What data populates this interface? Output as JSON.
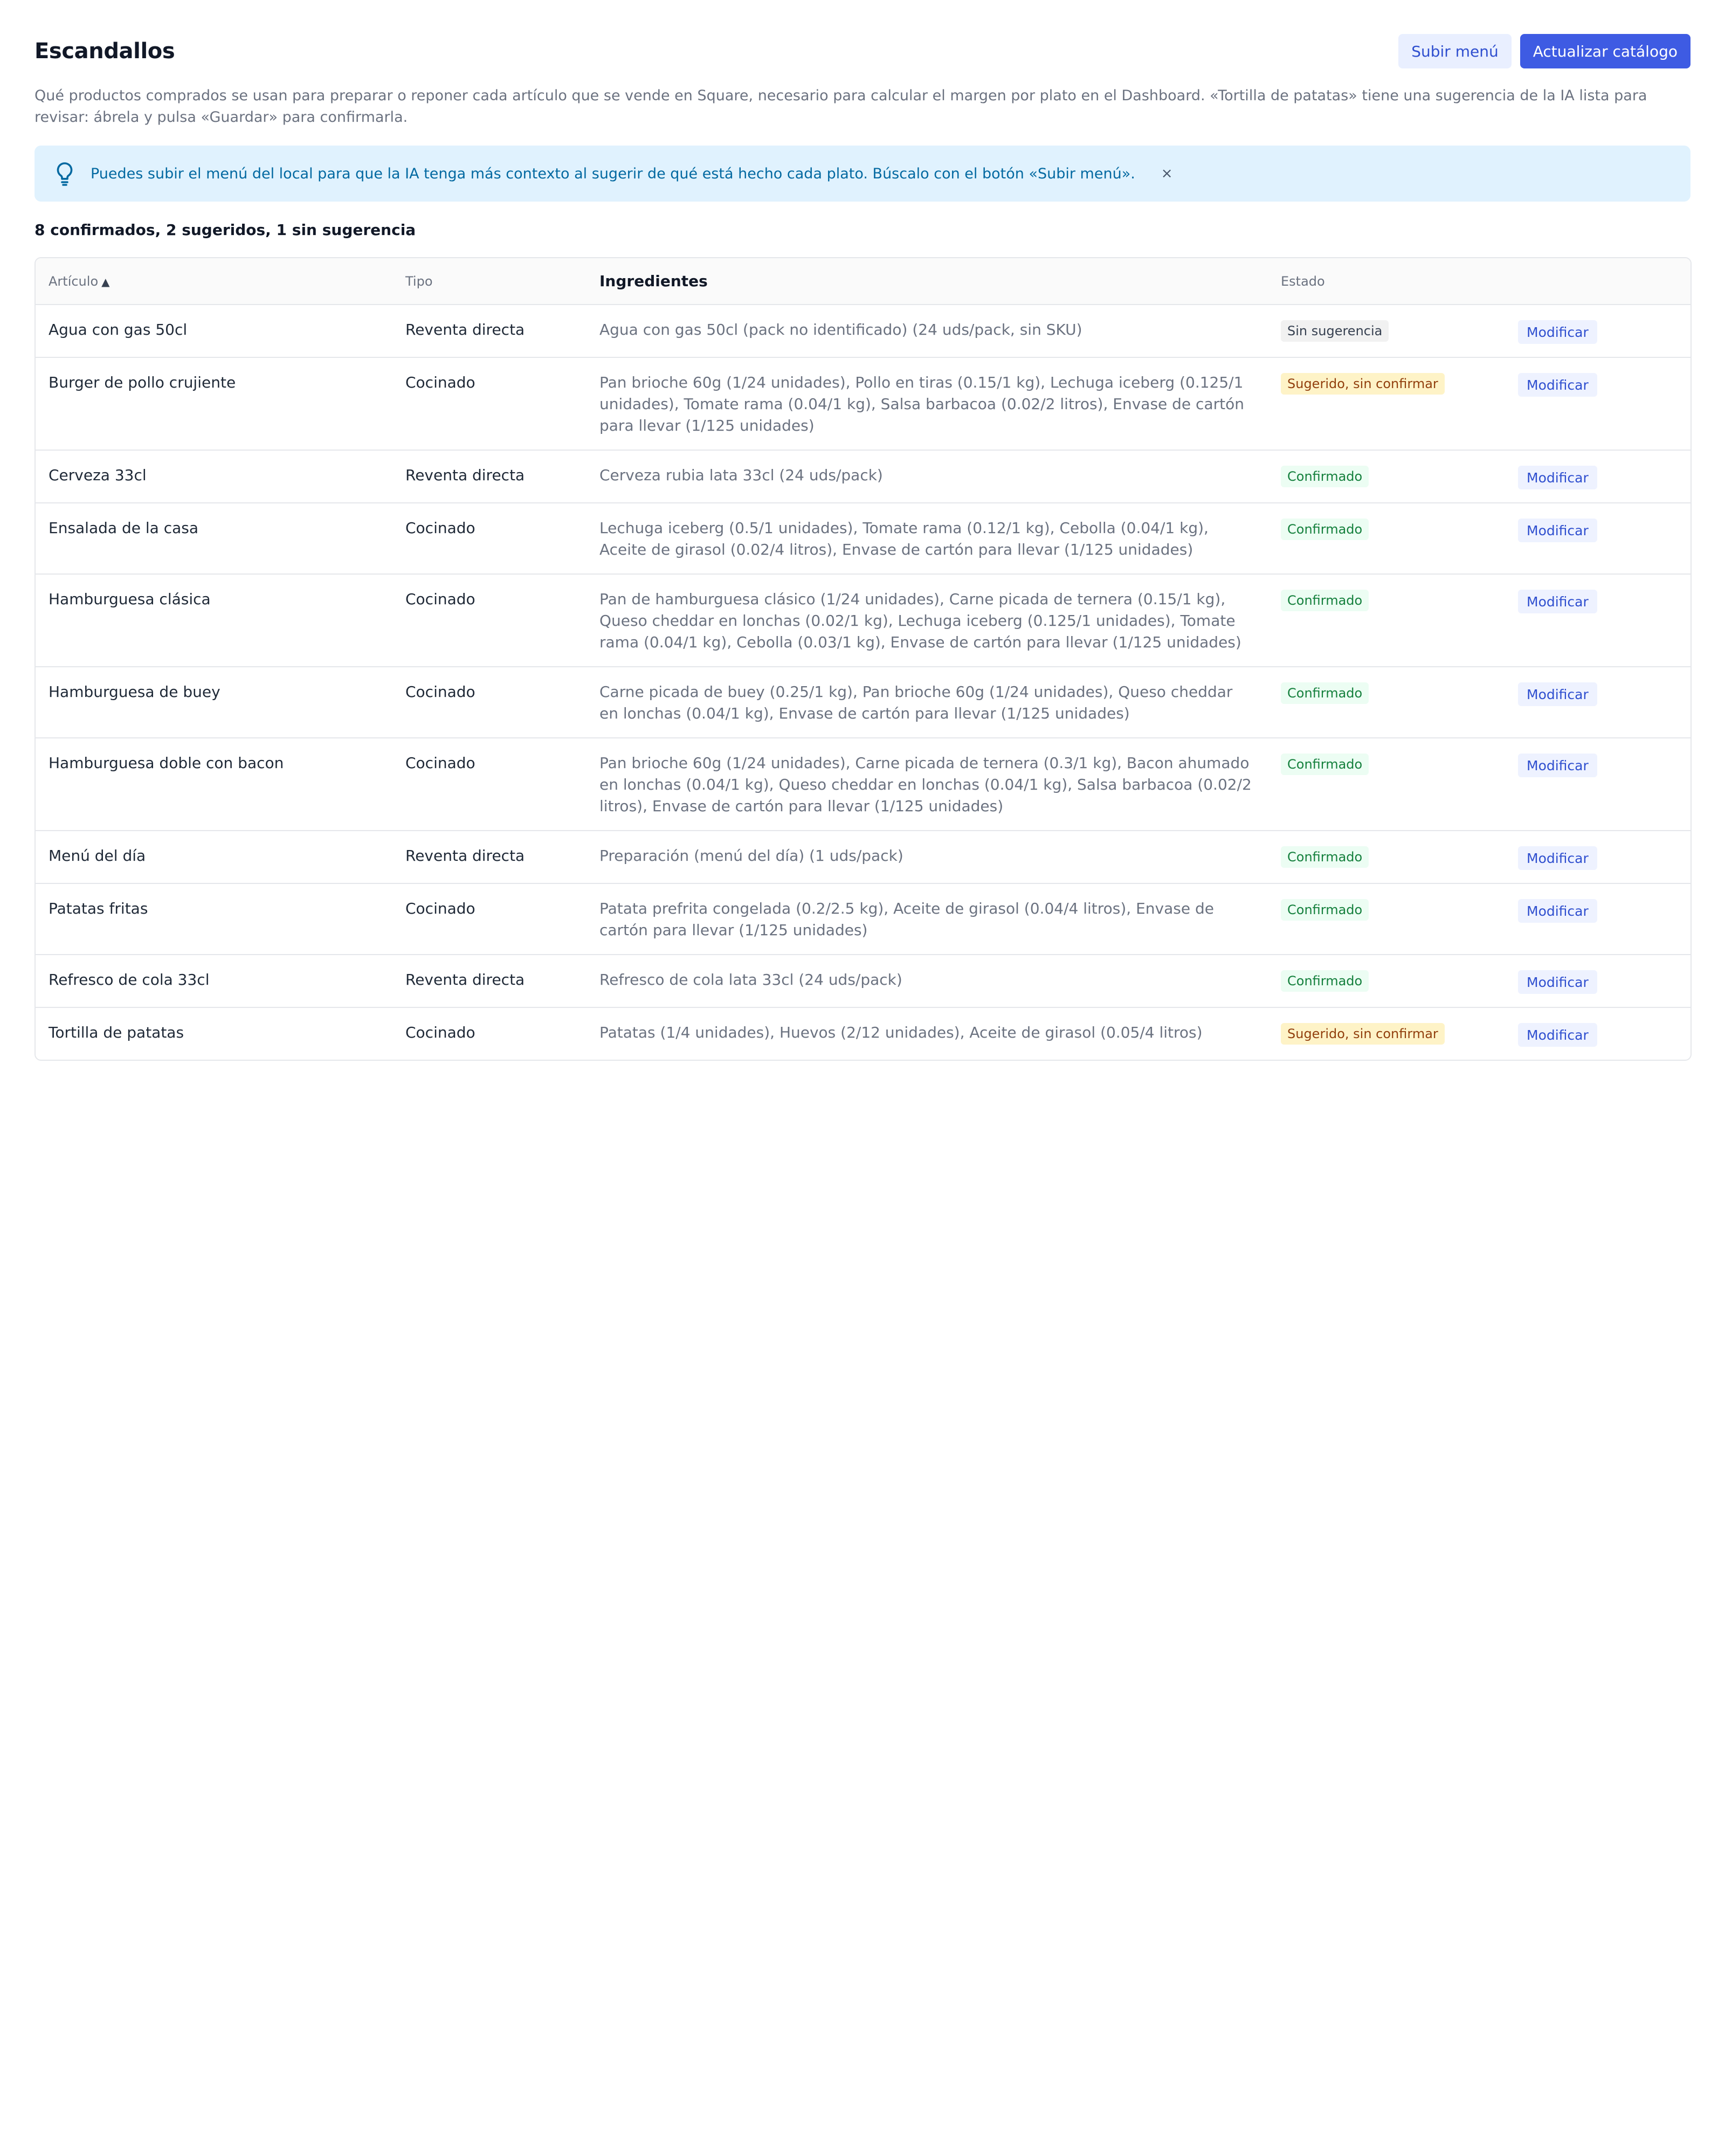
{
  "header": {
    "title": "Escandallos",
    "upload_menu_label": "Subir menú",
    "update_catalog_label": "Actualizar catálogo"
  },
  "description": "Qué productos comprados se usan para preparar o reponer cada artículo que se vende en Square, necesario para calcular el margen por plato en el Dashboard. «Tortilla de patatas» tiene una sugerencia de la IA lista para revisar: ábrela y pulsa «Guardar» para confirmarla.",
  "banner": {
    "icon": "lightbulb-icon",
    "text": "Puedes subir el menú del local para que la IA tenga más contexto al sugerir de qué está hecho cada plato. Búscalo con el botón «Subir menú».",
    "close": "×"
  },
  "summary": "8 confirmados, 2 sugeridos, 1 sin sugerencia",
  "table": {
    "columns": {
      "article": "Artículo",
      "sort_indicator": "▲",
      "type": "Tipo",
      "ingredients": "Ingredientes",
      "status": "Estado"
    },
    "action_label": "Modificar",
    "rows": [
      {
        "article": "Agua con gas 50cl",
        "type": "Reventa directa",
        "ingredients": "Agua con gas 50cl (pack no identificado) (24 uds/pack, sin SKU)",
        "status": "Sin sugerencia",
        "status_kind": "gray"
      },
      {
        "article": "Burger de pollo crujiente",
        "type": "Cocinado",
        "ingredients": "Pan brioche 60g (1/24 unidades), Pollo en tiras (0.15/1 kg), Lechuga iceberg (0.125/1 unidades), Tomate rama (0.04/1 kg), Salsa barbacoa (0.02/2 litros), Envase de cartón para llevar (1/125 unidades)",
        "status": "Sugerido, sin confirmar",
        "status_kind": "yellow"
      },
      {
        "article": "Cerveza 33cl",
        "type": "Reventa directa",
        "ingredients": "Cerveza rubia lata 33cl (24 uds/pack)",
        "status": "Confirmado",
        "status_kind": "green"
      },
      {
        "article": "Ensalada de la casa",
        "type": "Cocinado",
        "ingredients": "Lechuga iceberg (0.5/1 unidades), Tomate rama (0.12/1 kg), Cebolla (0.04/1 kg), Aceite de girasol (0.02/4 litros), Envase de cartón para llevar (1/125 unidades)",
        "status": "Confirmado",
        "status_kind": "green"
      },
      {
        "article": "Hamburguesa clásica",
        "type": "Cocinado",
        "ingredients": "Pan de hamburguesa clásico (1/24 unidades), Carne picada de ternera (0.15/1 kg), Queso cheddar en lonchas (0.02/1 kg), Lechuga iceberg (0.125/1 unidades), Tomate rama (0.04/1 kg), Cebolla (0.03/1 kg), Envase de cartón para llevar (1/125 unidades)",
        "status": "Confirmado",
        "status_kind": "green"
      },
      {
        "article": "Hamburguesa de buey",
        "type": "Cocinado",
        "ingredients": "Carne picada de buey (0.25/1 kg), Pan brioche 60g (1/24 unidades), Queso cheddar en lonchas (0.04/1 kg), Envase de cartón para llevar (1/125 unidades)",
        "status": "Confirmado",
        "status_kind": "green"
      },
      {
        "article": "Hamburguesa doble con bacon",
        "type": "Cocinado",
        "ingredients": "Pan brioche 60g (1/24 unidades), Carne picada de ternera (0.3/1 kg), Bacon ahumado en lonchas (0.04/1 kg), Queso cheddar en lonchas (0.04/1 kg), Salsa barbacoa (0.02/2 litros), Envase de cartón para llevar (1/125 unidades)",
        "status": "Confirmado",
        "status_kind": "green"
      },
      {
        "article": "Menú del día",
        "type": "Reventa directa",
        "ingredients": "Preparación (menú del día) (1 uds/pack)",
        "status": "Confirmado",
        "status_kind": "green"
      },
      {
        "article": "Patatas fritas",
        "type": "Cocinado",
        "ingredients": "Patata prefrita congelada (0.2/2.5 kg), Aceite de girasol (0.04/4 litros), Envase de cartón para llevar (1/125 unidades)",
        "status": "Confirmado",
        "status_kind": "green"
      },
      {
        "article": "Refresco de cola 33cl",
        "type": "Reventa directa",
        "ingredients": "Refresco de cola lata 33cl (24 uds/pack)",
        "status": "Confirmado",
        "status_kind": "green"
      },
      {
        "article": "Tortilla de patatas",
        "type": "Cocinado",
        "ingredients": "Patatas (1/4 unidades), Huevos (2/12 unidades), Aceite de girasol (0.05/4 litros)",
        "status": "Sugerido, sin confirmar",
        "status_kind": "yellow"
      }
    ]
  },
  "colors": {
    "primary": "#3e5be3",
    "secondary_bg": "#e9efff",
    "banner_bg": "#e0f2fe",
    "banner_text": "#0369a1",
    "badge_green": "#15803d",
    "badge_yellow": "#92400e"
  }
}
